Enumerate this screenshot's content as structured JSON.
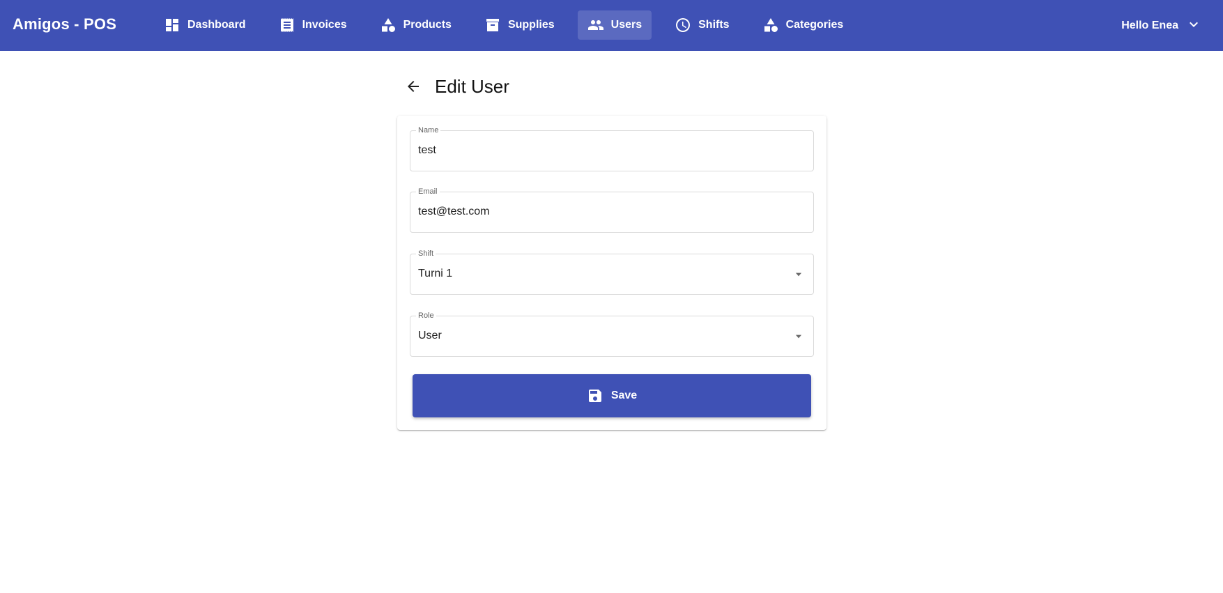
{
  "app": {
    "title": "Amigos - POS"
  },
  "nav": {
    "items": [
      {
        "label": "Dashboard",
        "icon": "dashboard-icon",
        "active": false
      },
      {
        "label": "Invoices",
        "icon": "receipt-icon",
        "active": false
      },
      {
        "label": "Products",
        "icon": "category-shapes-icon",
        "active": false
      },
      {
        "label": "Supplies",
        "icon": "archive-box-icon",
        "active": false
      },
      {
        "label": "Users",
        "icon": "people-icon",
        "active": true
      },
      {
        "label": "Shifts",
        "icon": "clock-icon",
        "active": false
      },
      {
        "label": "Categories",
        "icon": "category-shapes-icon",
        "active": false
      }
    ]
  },
  "user_menu": {
    "greeting": "Hello Enea",
    "icon": "chevron-down-icon"
  },
  "page": {
    "title": "Edit User",
    "back_icon": "arrow-back-icon"
  },
  "form": {
    "name": {
      "label": "Name",
      "value": "test"
    },
    "email": {
      "label": "Email",
      "value": "test@test.com"
    },
    "shift": {
      "label": "Shift",
      "value": "Turni 1"
    },
    "role": {
      "label": "Role",
      "value": "User"
    },
    "save_label": "Save",
    "save_icon": "save-floppy-icon"
  },
  "colors": {
    "primary": "#3f51b5",
    "background": "#ffffff"
  }
}
